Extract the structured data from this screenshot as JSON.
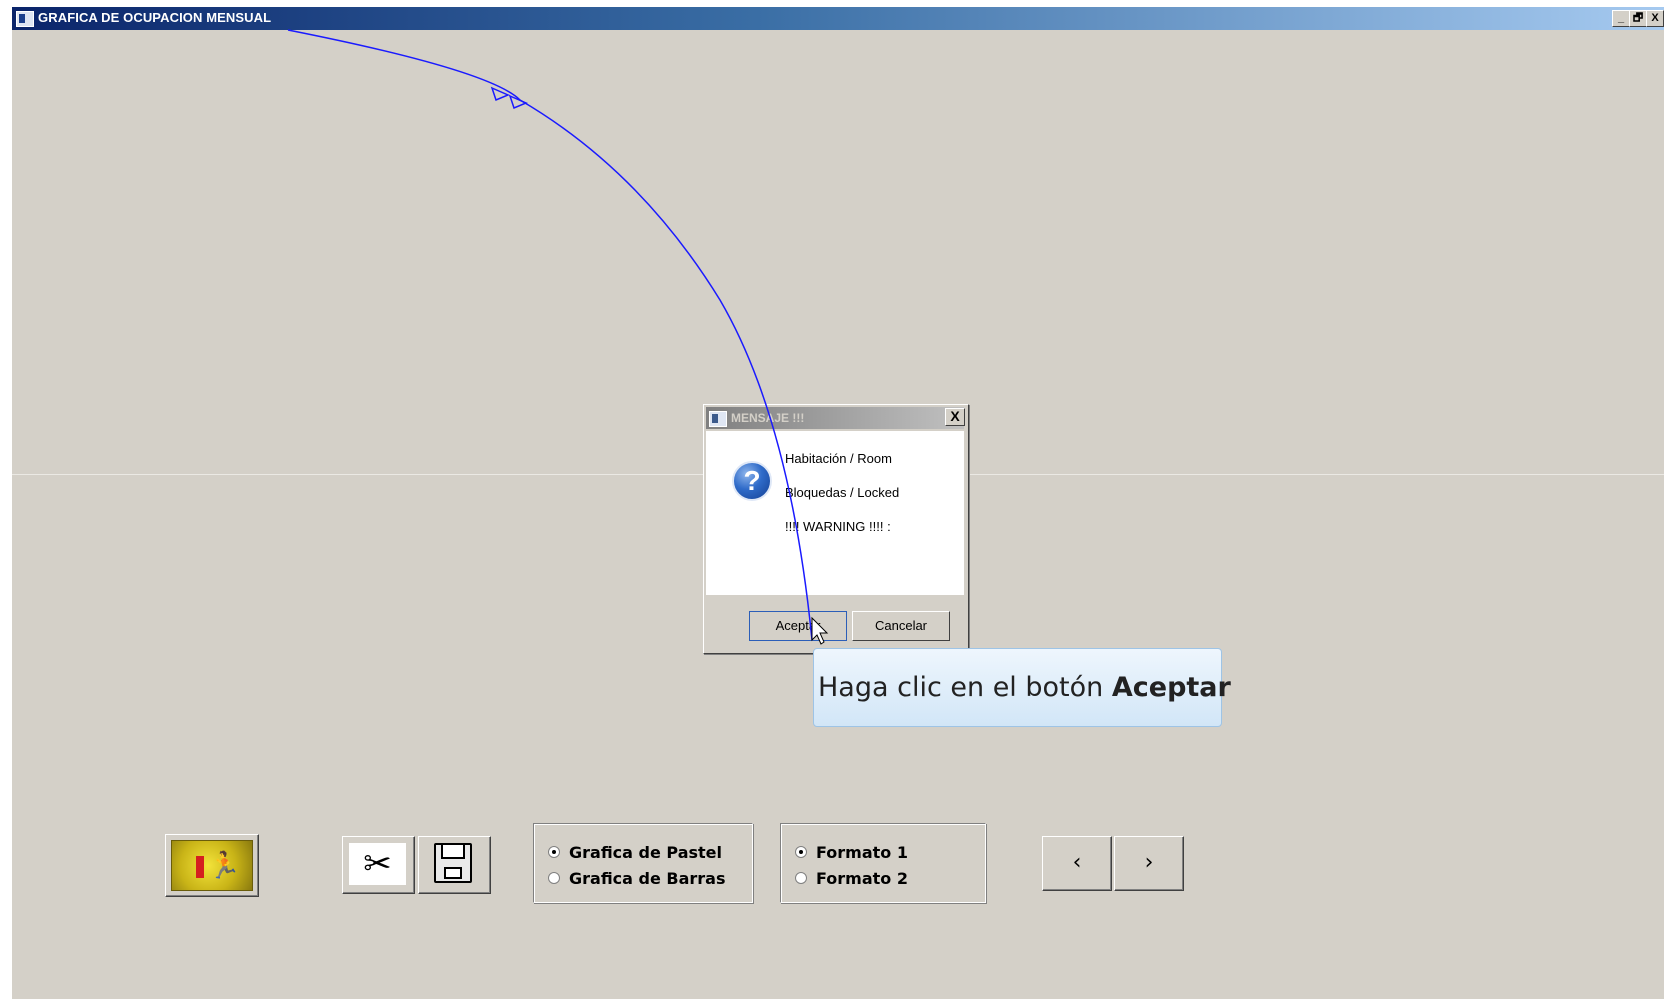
{
  "window": {
    "title": "GRAFICA DE OCUPACION MENSUAL",
    "controls": {
      "minimize": "_",
      "restore": "🗗",
      "close": "X"
    }
  },
  "dialog": {
    "title": "MENSAJE !!!",
    "close": "X",
    "icon": "question-icon",
    "icon_glyph": "?",
    "lines": [
      "Habitación / Room",
      "Bloquedas / Locked",
      "!!!! WARNING !!!! :"
    ],
    "ok_label": "Aceptar",
    "cancel_label": "Cancelar"
  },
  "tooltip": {
    "text": "Haga clic en el botón ",
    "emphasis": "Aceptar"
  },
  "toolbar": {
    "exit_icon": "exit-runner-icon",
    "exit_glyph": "🏃",
    "cut_icon": "scissors-icon",
    "cut_glyph": "✂",
    "save_icon": "floppy-disk-icon",
    "chart_options": [
      {
        "label": "Grafica de Pastel",
        "checked": true
      },
      {
        "label": "Grafica de Barras",
        "checked": false
      }
    ],
    "format_options": [
      {
        "label": "Formato 1",
        "checked": true
      },
      {
        "label": "Formato 2",
        "checked": false
      }
    ],
    "prev_label": "‹",
    "next_label": "›"
  },
  "colors": {
    "window_bg": "#d4d0c8",
    "titlebar_start": "#0a246a",
    "titlebar_end": "#a6caf0",
    "annotation_line": "#1a1aff"
  }
}
